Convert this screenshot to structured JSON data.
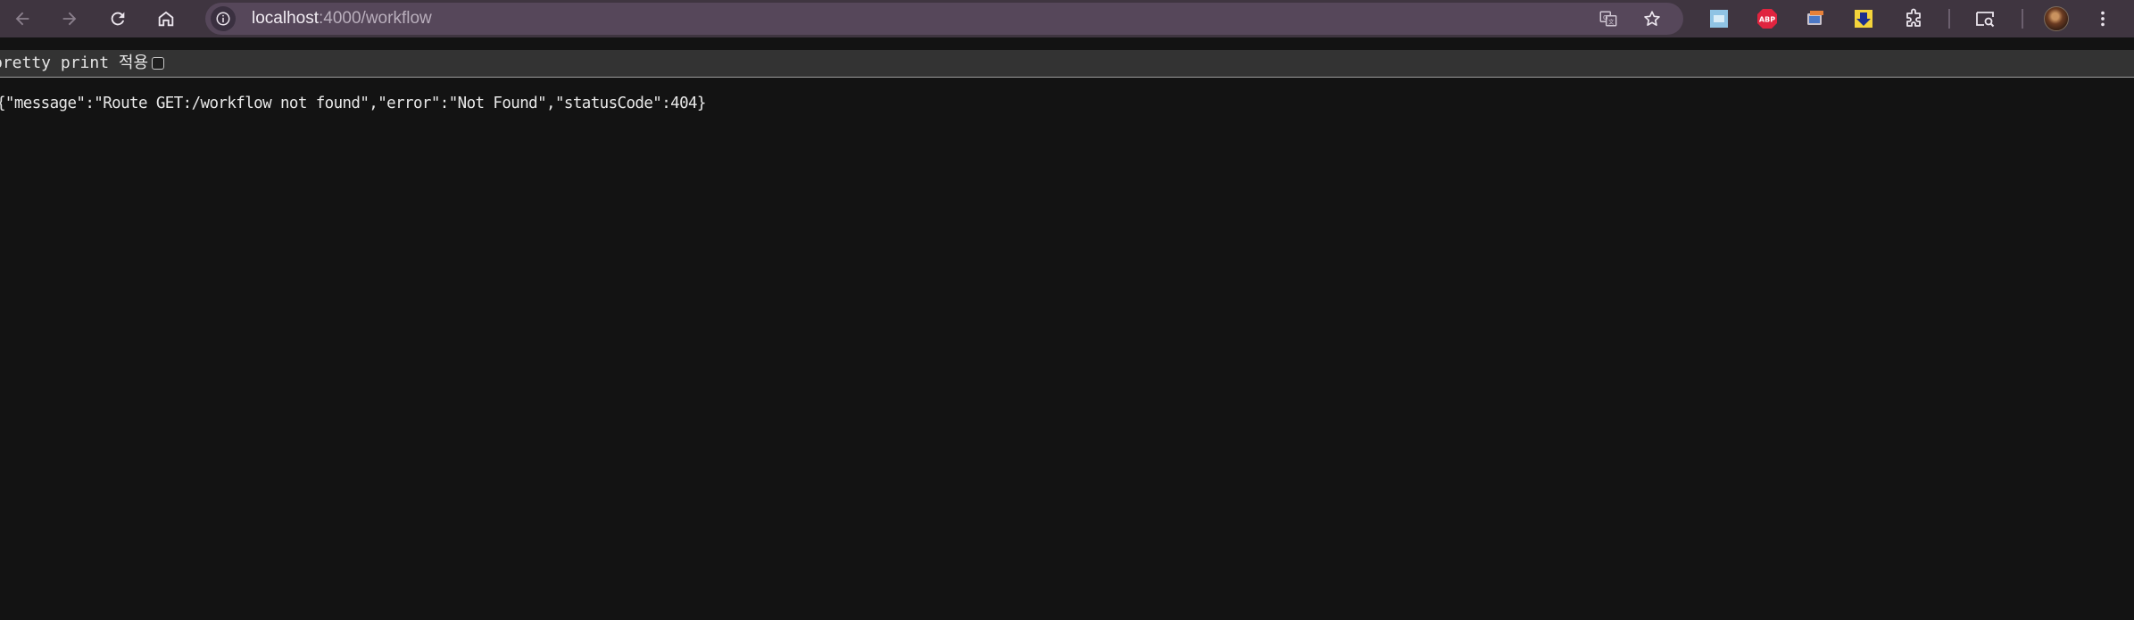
{
  "browser": {
    "url_host": "localhost",
    "url_path": ":4000/workflow",
    "nav_icons": [
      "back-arrow-icon",
      "forward-arrow-icon",
      "reload-icon",
      "home-icon"
    ],
    "omnibox_icons": [
      "site-info-icon",
      "translate-icon",
      "bookmark-star-icon"
    ],
    "extensions": [
      "zoom-extension-icon",
      "adblock-plus-icon",
      "screen-capture-icon",
      "download-extension-icon",
      "extensions-puzzle-icon",
      "tab-search-icon"
    ],
    "extension_labels": {
      "adblock": "ABP"
    },
    "colors": {
      "toolbar": "#3f3540",
      "omnibox": "#56475a",
      "adblock": "#e0243f"
    }
  },
  "viewer": {
    "pretty_print_label": "pretty print 적용",
    "pretty_print_checked": false,
    "json_text": "{\"message\":\"Route GET:/workflow not found\",\"error\":\"Not Found\",\"statusCode\":404}"
  }
}
